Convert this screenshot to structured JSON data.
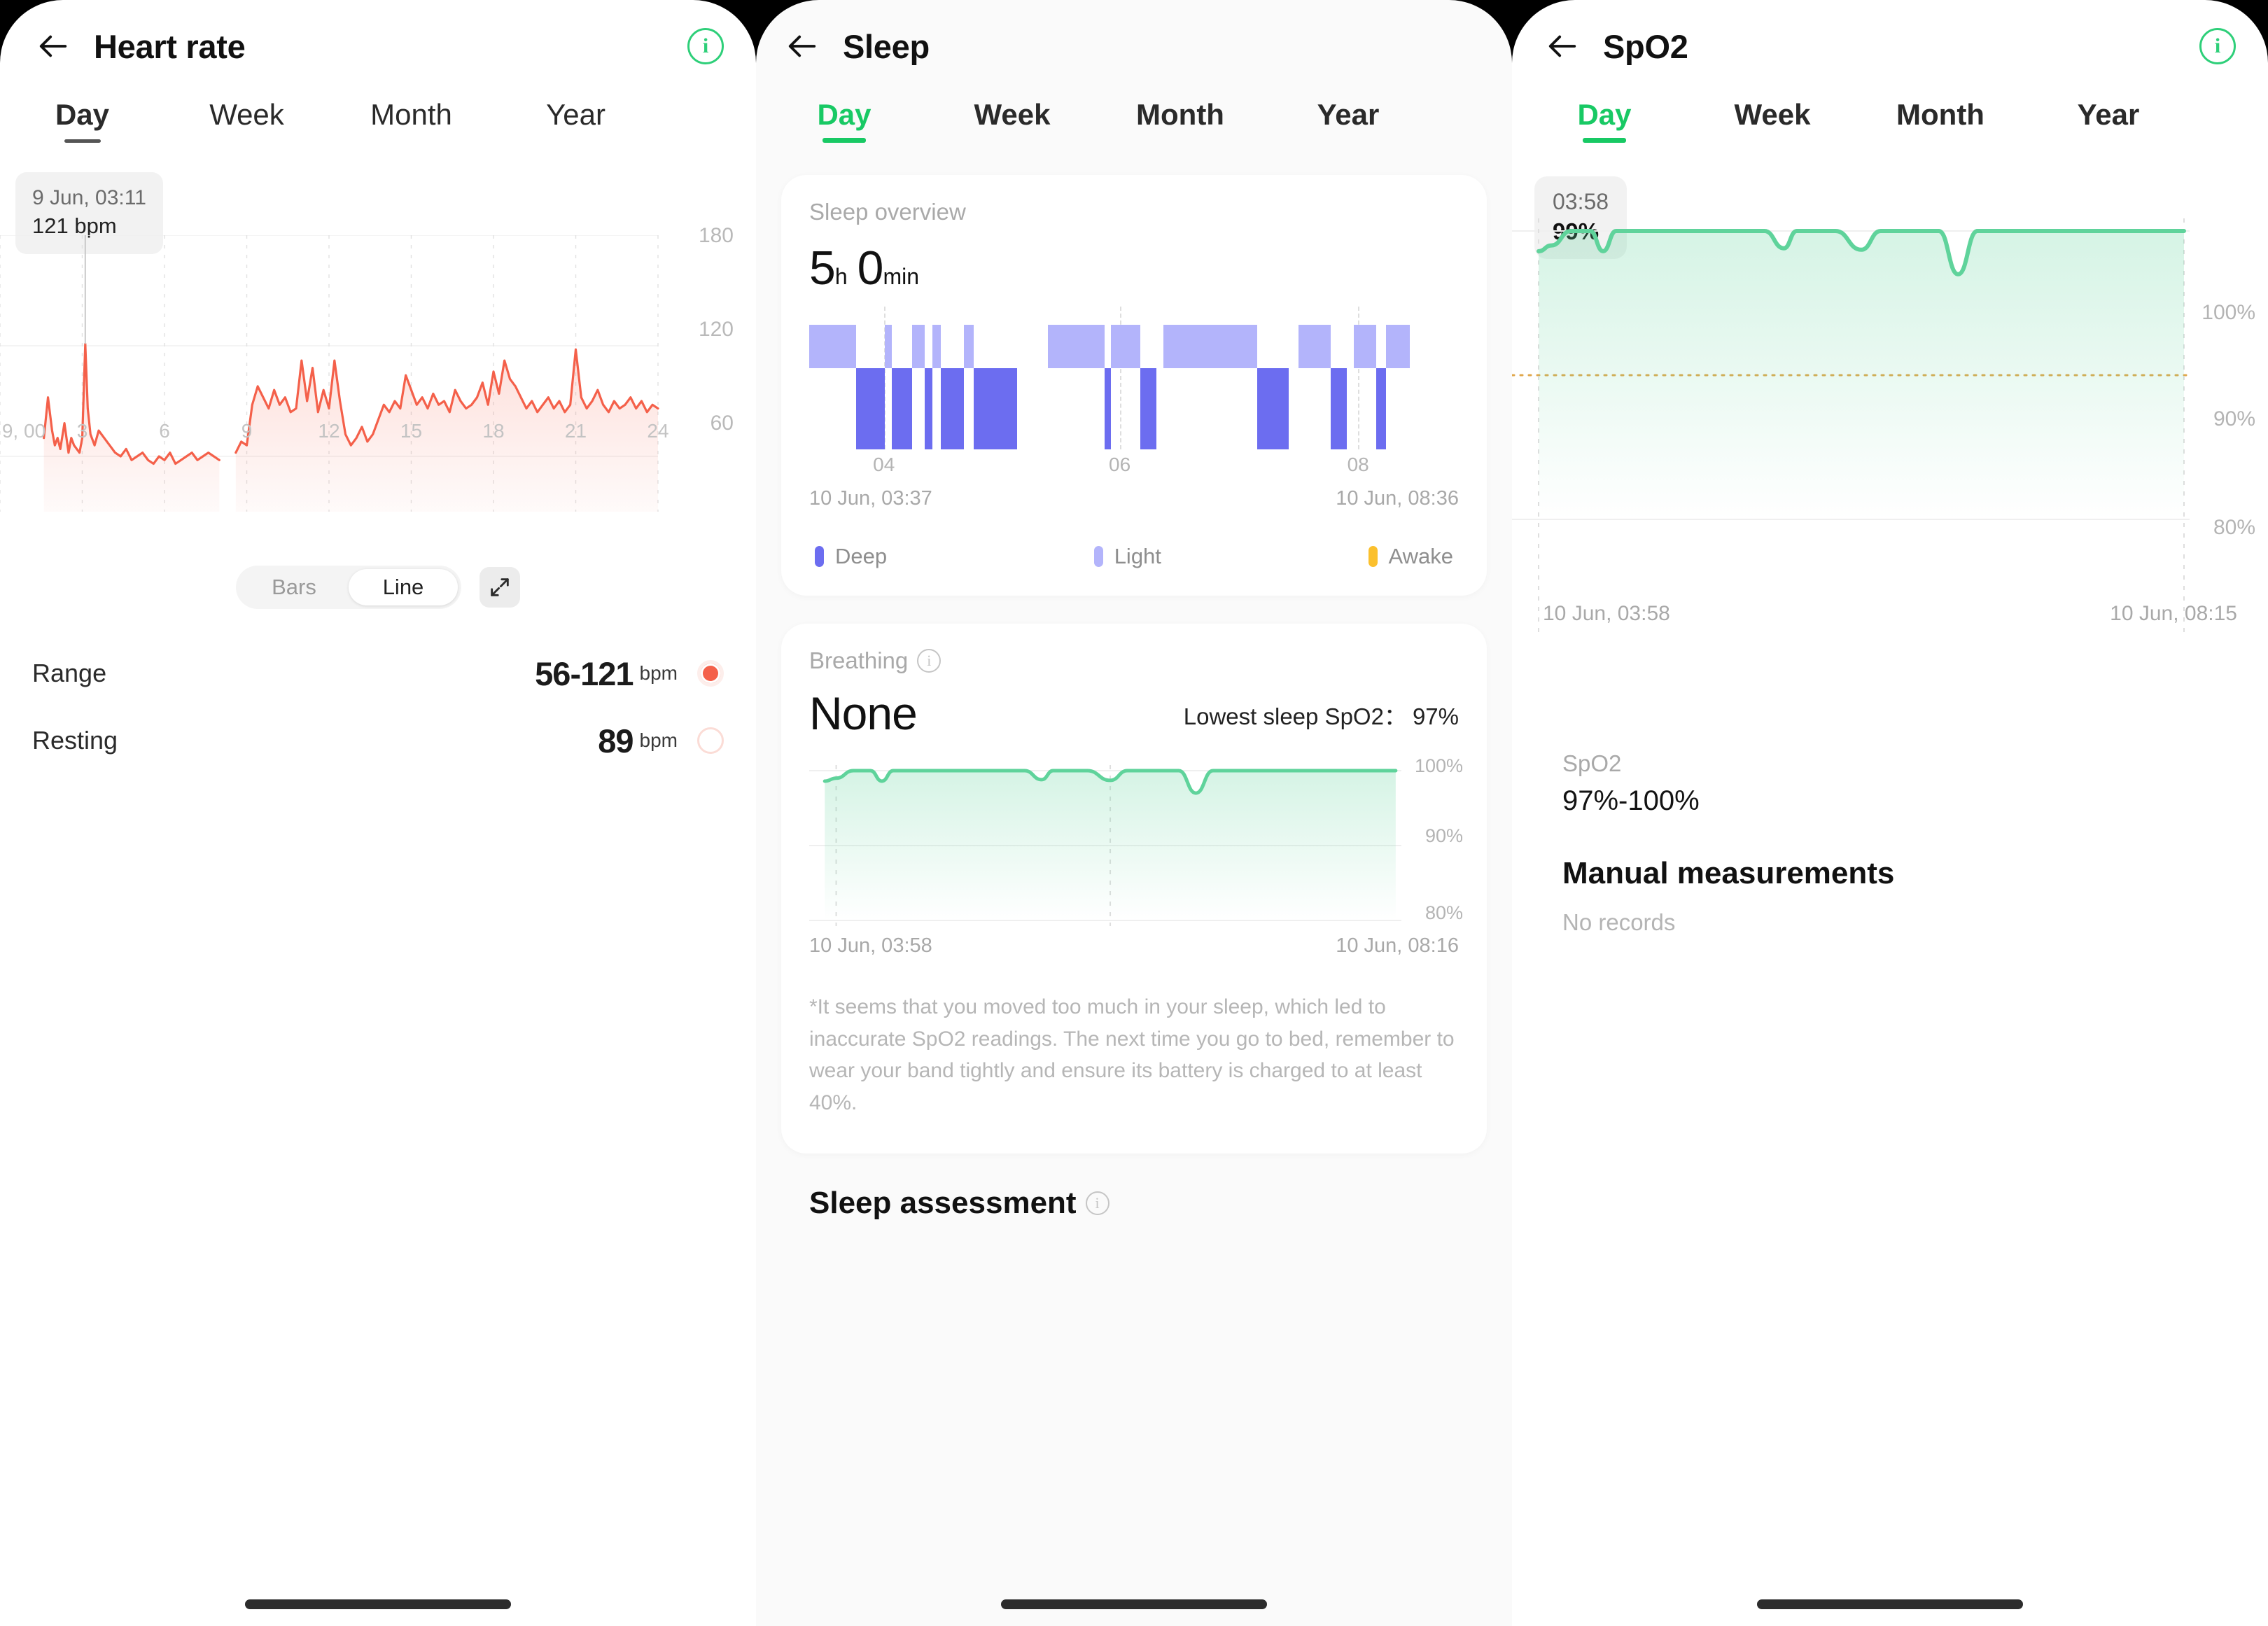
{
  "panels": {
    "heart_rate": {
      "title": "Heart rate",
      "back_icon": "arrow-left-icon",
      "info_icon": "info-icon",
      "tabs": [
        {
          "label": "Day",
          "active": true
        },
        {
          "label": "Week",
          "active": false
        },
        {
          "label": "Month",
          "active": false
        },
        {
          "label": "Year",
          "active": false
        }
      ],
      "tooltip": {
        "time": "9 Jun, 03:11",
        "value": "121 bpm"
      },
      "chart_view": {
        "bars_label": "Bars",
        "line_label": "Line",
        "selected": "Line",
        "expand_icon": "expand-icon"
      },
      "stats": [
        {
          "label": "Range",
          "value": "56-121",
          "unit": "bpm",
          "marker": "filled"
        },
        {
          "label": "Resting",
          "value": "89",
          "unit": "bpm",
          "marker": "hollow"
        }
      ]
    },
    "sleep": {
      "title": "Sleep",
      "back_icon": "arrow-left-icon",
      "tabs": [
        {
          "label": "Day",
          "active": true
        },
        {
          "label": "Week",
          "active": false
        },
        {
          "label": "Month",
          "active": false
        },
        {
          "label": "Year",
          "active": false
        }
      ],
      "overview": {
        "label": "Sleep overview",
        "hours": "5",
        "hours_unit": "h",
        "minutes": "0",
        "minutes_unit": "min",
        "start": "10 Jun, 03:37",
        "end": "10 Jun, 08:36",
        "legend": [
          {
            "label": "Deep",
            "color": "#6c6df0"
          },
          {
            "label": "Light",
            "color": "#b3b4fb"
          },
          {
            "label": "Awake",
            "color": "#fbc02d"
          }
        ]
      },
      "breathing": {
        "label": "Breathing",
        "info_icon": "info-icon",
        "value": "None",
        "lowest_label": "Lowest sleep SpO2：",
        "lowest_value": "97%",
        "start": "10 Jun, 03:58",
        "end": "10 Jun, 08:16",
        "note": "*It seems that you moved too much in your sleep, which led to inaccurate SpO2 readings. The next time you go to bed, remember to wear your band tightly and ensure its battery is charged to at least 40%."
      },
      "assessment": {
        "label": "Sleep assessment",
        "info_icon": "info-icon"
      }
    },
    "spo2": {
      "title": "SpO2",
      "back_icon": "arrow-left-icon",
      "info_icon": "info-icon",
      "tabs": [
        {
          "label": "Day",
          "active": true
        },
        {
          "label": "Week",
          "active": false
        },
        {
          "label": "Month",
          "active": false
        },
        {
          "label": "Year",
          "active": false
        }
      ],
      "tooltip": {
        "time": "03:58",
        "value": "99%"
      },
      "start": "10 Jun, 03:58",
      "end": "10 Jun, 08:15",
      "stats": {
        "label": "SpO2",
        "value": "97%-100%"
      },
      "manual": {
        "title": "Manual measurements",
        "empty": "No records"
      }
    }
  },
  "colors": {
    "heart_line": "#f4604a",
    "green_accent": "#18c964",
    "spo2_line": "#5fd39b",
    "deep_sleep": "#6c6df0",
    "light_sleep": "#b3b4fb",
    "awake": "#fbc02d",
    "threshold_line": "#e0a84e"
  },
  "chart_data": [
    {
      "type": "line",
      "name": "heart-rate-day",
      "title": "Heart rate",
      "ylabel": "bpm",
      "ylim": [
        30,
        180
      ],
      "yticks": [
        60,
        120,
        180
      ],
      "xlabel": "",
      "xticks": [
        "9, 00",
        "3",
        "6",
        "9",
        "12",
        "15",
        "18",
        "21",
        "24"
      ],
      "xlim": [
        0,
        24
      ],
      "grid": true,
      "annotation": {
        "x": 3.11,
        "y": 121,
        "text": "9 Jun, 03:11 / 121 bpm"
      },
      "range_min": 56,
      "range_max": 121,
      "resting": 89,
      "series": [
        {
          "name": "Heart rate",
          "color": "#f4604a",
          "x": [
            1.6,
            1.75,
            1.9,
            2.0,
            2.1,
            2.2,
            2.35,
            2.5,
            2.6,
            2.7,
            2.8,
            2.9,
            3.0,
            3.11,
            3.2,
            3.3,
            3.45,
            3.6,
            3.8,
            4.0,
            4.2,
            4.4,
            4.6,
            4.8,
            5.0,
            5.2,
            5.4,
            5.6,
            5.8,
            6.0,
            6.2,
            6.4,
            6.6,
            6.8,
            7.0,
            7.2,
            7.4,
            7.6,
            7.8,
            8.0,
            8.6,
            8.8,
            9.0,
            9.2,
            9.4,
            9.6,
            9.8,
            10.0,
            10.2,
            10.4,
            10.6,
            10.8,
            11.0,
            11.2,
            11.4,
            11.6,
            11.8,
            12.0,
            12.2,
            12.4,
            12.6,
            12.8,
            13.0,
            13.2,
            13.4,
            13.6,
            13.8,
            14.0,
            14.2,
            14.4,
            14.6,
            14.8,
            15.0,
            15.2,
            15.4,
            15.6,
            15.8,
            16.0,
            16.2,
            16.4,
            16.6,
            16.8,
            17.0,
            17.2,
            17.4,
            17.6,
            17.8,
            18.0,
            18.2,
            18.4,
            18.6,
            18.8,
            19.0,
            19.2,
            19.4,
            19.6,
            19.8,
            20.0,
            20.2,
            20.4,
            20.6,
            20.8,
            21.0,
            21.2,
            21.4,
            21.6,
            21.8,
            22.0,
            22.2,
            22.4,
            22.6,
            22.8,
            23.0,
            23.2,
            23.4,
            23.6,
            23.8,
            24.0
          ],
          "y": [
            70,
            92,
            74,
            66,
            70,
            64,
            78,
            62,
            70,
            66,
            64,
            62,
            70,
            121,
            86,
            72,
            66,
            74,
            70,
            66,
            62,
            60,
            64,
            58,
            60,
            62,
            58,
            56,
            60,
            58,
            62,
            56,
            58,
            60,
            62,
            58,
            60,
            62,
            60,
            58,
            62,
            68,
            66,
            88,
            98,
            92,
            86,
            96,
            88,
            92,
            84,
            86,
            112,
            90,
            108,
            84,
            96,
            86,
            112,
            90,
            72,
            66,
            70,
            76,
            68,
            72,
            80,
            88,
            84,
            90,
            86,
            104,
            96,
            88,
            92,
            86,
            94,
            88,
            90,
            84,
            96,
            90,
            86,
            88,
            92,
            100,
            88,
            106,
            94,
            112,
            102,
            98,
            92,
            86,
            90,
            84,
            88,
            92,
            86,
            90,
            84,
            88,
            118,
            92,
            86,
            90,
            96,
            88,
            84,
            90,
            86,
            88,
            92,
            86,
            90,
            84,
            88,
            86
          ]
        }
      ]
    },
    {
      "type": "bar",
      "name": "sleep-stages",
      "title": "Sleep overview",
      "start_label": "10 Jun, 03:37",
      "end_label": "10 Jun, 08:36",
      "xticks": [
        "04",
        "06",
        "08"
      ],
      "xtick_pos": [
        0.115,
        0.478,
        0.845
      ],
      "legend": [
        "Deep",
        "Light",
        "Awake"
      ],
      "segments": [
        {
          "stage": "Light",
          "start": 0.0,
          "end": 0.072
        },
        {
          "stage": "Deep",
          "start": 0.072,
          "end": 0.116
        },
        {
          "stage": "Light",
          "start": 0.116,
          "end": 0.127
        },
        {
          "stage": "Deep",
          "start": 0.127,
          "end": 0.158
        },
        {
          "stage": "Light",
          "start": 0.158,
          "end": 0.178
        },
        {
          "stage": "Deep",
          "start": 0.178,
          "end": 0.19
        },
        {
          "stage": "Light",
          "start": 0.19,
          "end": 0.203
        },
        {
          "stage": "Deep",
          "start": 0.203,
          "end": 0.238
        },
        {
          "stage": "Light",
          "start": 0.238,
          "end": 0.253
        },
        {
          "stage": "Deep",
          "start": 0.253,
          "end": 0.32
        },
        {
          "stage": "Light",
          "start": 0.367,
          "end": 0.455
        },
        {
          "stage": "Deep",
          "start": 0.455,
          "end": 0.464
        },
        {
          "stage": "Light",
          "start": 0.464,
          "end": 0.51
        },
        {
          "stage": "Deep",
          "start": 0.51,
          "end": 0.535
        },
        {
          "stage": "Light",
          "start": 0.545,
          "end": 0.69
        },
        {
          "stage": "Deep",
          "start": 0.69,
          "end": 0.738
        },
        {
          "stage": "Light",
          "start": 0.753,
          "end": 0.803
        },
        {
          "stage": "Deep",
          "start": 0.803,
          "end": 0.828
        },
        {
          "stage": "Light",
          "start": 0.838,
          "end": 0.873
        },
        {
          "stage": "Deep",
          "start": 0.873,
          "end": 0.888
        },
        {
          "stage": "Light",
          "start": 0.888,
          "end": 0.925
        }
      ]
    },
    {
      "type": "area",
      "name": "sleep-spo2-mini",
      "title": "Breathing",
      "ylim": [
        80,
        100
      ],
      "yticks": [
        "100%",
        "90%",
        "80%"
      ],
      "start_label": "10 Jun, 03:58",
      "end_label": "10 Jun, 08:16",
      "lowest": 97,
      "series": [
        {
          "name": "SpO2",
          "color": "#5fd39b",
          "x": [
            0,
            0.02,
            0.05,
            0.08,
            0.1,
            0.12,
            0.14,
            0.17,
            0.2,
            0.3,
            0.35,
            0.38,
            0.4,
            0.43,
            0.46,
            0.5,
            0.53,
            0.55,
            0.58,
            0.62,
            0.65,
            0.68,
            0.7,
            0.72,
            0.75,
            0.8,
            0.9,
            1.0
          ],
          "y": [
            98.6,
            99,
            100,
            100,
            98.6,
            100,
            100,
            100,
            100,
            100,
            100,
            98.8,
            100,
            100,
            100,
            98.7,
            100,
            100,
            100,
            100,
            97,
            100,
            100,
            100,
            100,
            100,
            100,
            100
          ]
        }
      ]
    },
    {
      "type": "area",
      "name": "spo2-day",
      "title": "SpO2",
      "ylim": [
        75,
        101
      ],
      "yticks": [
        "100%",
        "90%",
        "80%"
      ],
      "threshold": {
        "value": 90,
        "color": "#e0a84e",
        "style": "dotted"
      },
      "start_label": "10 Jun, 03:58",
      "end_label": "10 Jun, 08:15",
      "annotation": {
        "time": "03:58",
        "value": "99%"
      },
      "range": "97%-100%",
      "series": [
        {
          "name": "SpO2",
          "color": "#5fd39b",
          "x": [
            0,
            0.02,
            0.05,
            0.08,
            0.1,
            0.12,
            0.14,
            0.17,
            0.2,
            0.3,
            0.35,
            0.38,
            0.4,
            0.43,
            0.46,
            0.5,
            0.53,
            0.55,
            0.58,
            0.62,
            0.65,
            0.68,
            0.7,
            0.72,
            0.75,
            0.8,
            0.9,
            1.0
          ],
          "y": [
            98.6,
            99,
            100,
            100,
            98.6,
            100,
            100,
            100,
            100,
            100,
            100,
            98.8,
            100,
            100,
            100,
            98.7,
            100,
            100,
            100,
            100,
            97,
            100,
            100,
            100,
            100,
            100,
            100,
            100
          ]
        }
      ]
    }
  ]
}
